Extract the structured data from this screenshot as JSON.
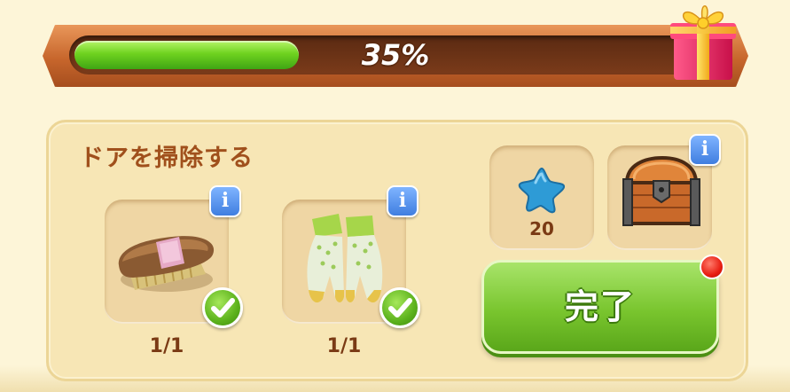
{
  "progress": {
    "percent_label": "35%",
    "fraction": 0.35
  },
  "task": {
    "title": "ドアを掃除する",
    "requirements": [
      {
        "item": "brush",
        "icon": "brush-icon",
        "count_label": "1/1",
        "completed": true
      },
      {
        "item": "gloves",
        "icon": "gloves-icon",
        "count_label": "1/1",
        "completed": true
      }
    ]
  },
  "rewards": [
    {
      "item": "star",
      "icon": "blue-star-icon",
      "amount_label": "20"
    },
    {
      "item": "chest",
      "icon": "treasure-chest-icon"
    }
  ],
  "buttons": {
    "complete_label": "完了"
  },
  "colors": {
    "progress_fill": "#6fd21f",
    "frame": "#c7662c",
    "button": "#79c52e",
    "title_text": "#a0501c",
    "notification": "#e81e12"
  }
}
